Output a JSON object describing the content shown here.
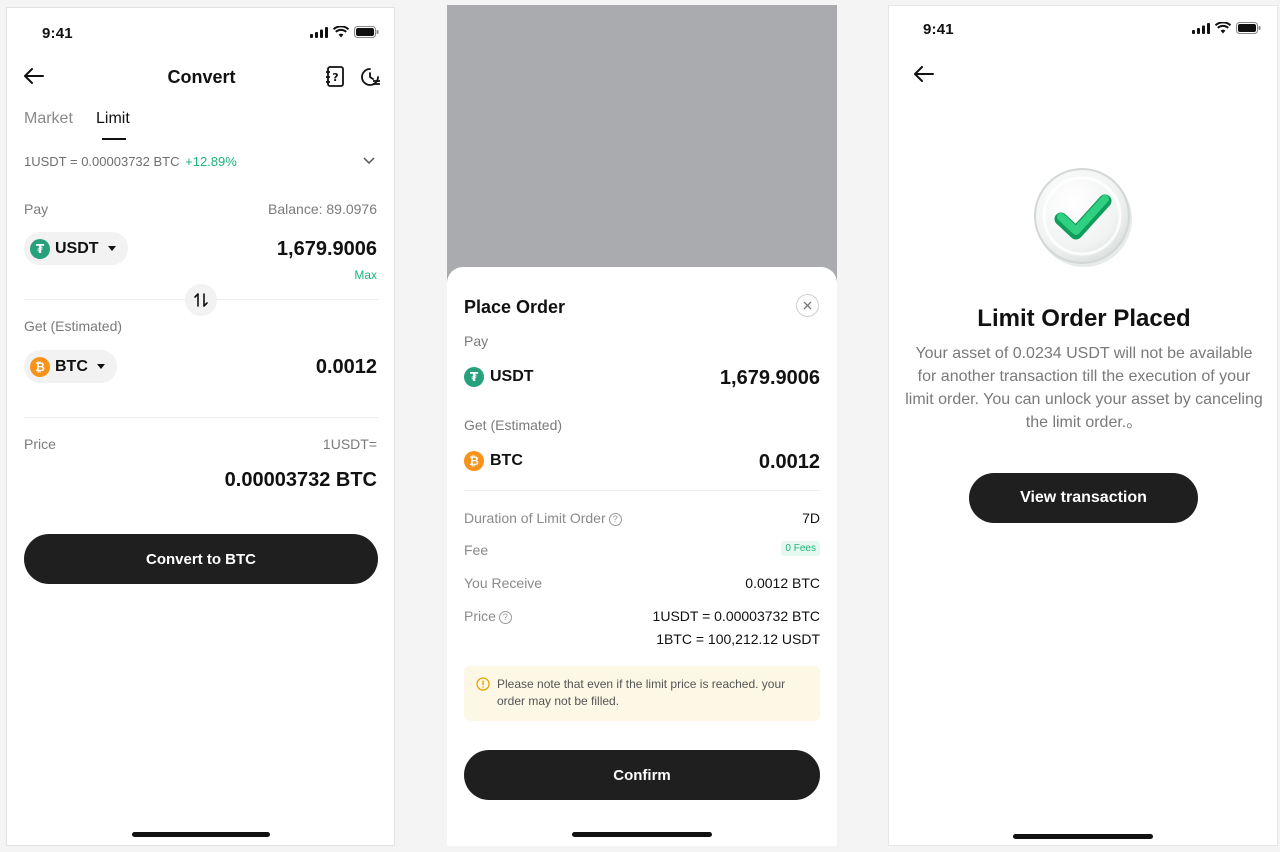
{
  "screen1": {
    "status_time": "9:41",
    "title": "Convert",
    "tabs": [
      {
        "label": "Market",
        "active": false
      },
      {
        "label": "Limit",
        "active": true
      }
    ],
    "rate_text": "1USDT = 0.00003732 BTC",
    "rate_change": "+12.89%",
    "pay_label": "Pay",
    "balance": "Balance: 89.0976",
    "pay_coin": "USDT",
    "pay_amount": "1,679.9006",
    "max_label": "Max",
    "get_label": "Get (Estimated)",
    "get_coin": "BTC",
    "get_amount": "0.0012",
    "price_label": "Price",
    "price_unit": "1USDT=",
    "price_value": "0.00003732 BTC",
    "convert_button": "Convert to BTC"
  },
  "screen2": {
    "sheet_title": "Place Order",
    "pay_label": "Pay",
    "pay_coin": "USDT",
    "pay_amount": "1,679.9006",
    "get_label": "Get (Estimated)",
    "get_coin": "BTC",
    "get_amount": "0.0012",
    "details": [
      {
        "label": "Duration of Limit Order",
        "value": "7D"
      },
      {
        "label": "Fee",
        "value": "0 Fees"
      },
      {
        "label": "You Receive",
        "value": "0.0012 BTC"
      },
      {
        "label": "Price",
        "value": "1USDT = 0.00003732 BTC",
        "value2": "1BTC = 100,212.12 USDT"
      }
    ],
    "notice": "Please note that even if the limit price is reached. your order may not be filled.",
    "confirm_button": "Confirm"
  },
  "screen3": {
    "status_time": "9:41",
    "title": "Limit Order Placed",
    "message": "Your asset of 0.0234 USDT will not be available for another transaction till the execution of your limit order. You can unlock your asset by canceling the limit order.。",
    "button": "View transaction"
  },
  "colors": {
    "accent_green": "#1db57a",
    "button_dark": "#1f1f1f",
    "usdt": "#26a17b",
    "btc": "#f7931a",
    "notice_bg": "#fdf7e6",
    "notice_icon": "#e8a200"
  }
}
